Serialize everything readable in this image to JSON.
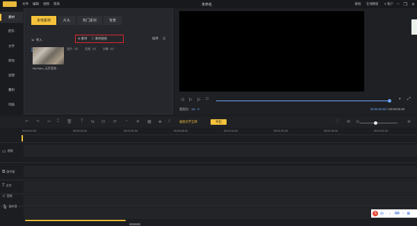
{
  "titlebar": {
    "menu": [
      "文件",
      "编辑",
      "视频",
      "帮助"
    ],
    "title": "未命名",
    "right": [
      "群组",
      "在线教程",
      "账户"
    ],
    "window_controls": [
      "minimize-icon",
      "restore-icon",
      "close-icon"
    ]
  },
  "sidebar": {
    "items": [
      {
        "label": "素材",
        "active": true
      },
      {
        "label": "配乐"
      },
      {
        "label": "文字"
      },
      {
        "label": "转场"
      },
      {
        "label": "滤镜"
      },
      {
        "label": "叠附"
      },
      {
        "label": "动画"
      }
    ]
  },
  "media": {
    "tabs": [
      "本地素材",
      "片头",
      "热门素材",
      "背景"
    ],
    "import_label": "导入",
    "red_options": [
      "素材",
      "素材链接"
    ],
    "sort_label": "排序",
    "filters": [
      "所有（1）",
      "视频（1）",
      "图片（0）",
      "音频（0）",
      "字幕（0）"
    ],
    "thumb_caption": "MyVideo_无声音频..."
  },
  "preview": {
    "ratio_label": "宽高比：",
    "ratio_value": "16：9",
    "time_current": "00:00:00.00",
    "time_total": " / 00:00:00.00",
    "playback_progress": 1.0
  },
  "toolbar": {
    "mode_button": "画面文字互转",
    "export_button": "导出",
    "zoom_level": 0.4
  },
  "ruler": {
    "ticks": [
      "00:00:00.00",
      "00:00:16.00",
      "00:00:32.00",
      "00:00:48.00",
      "00:01:04.00",
      "00:01:20.00",
      "00:01:36.00",
      "00:01:52.00"
    ]
  },
  "tracks": [
    {
      "label": "视频",
      "icon": "video-track-icon"
    },
    {
      "label": "画中画",
      "icon": "pip-track-icon"
    },
    {
      "label": "文字",
      "icon": "text-track-icon"
    },
    {
      "label": "音频",
      "icon": "music-track-icon"
    },
    {
      "label": "画外音",
      "icon": "voiceover-track-icon"
    }
  ],
  "tray": {
    "ime": "中"
  }
}
